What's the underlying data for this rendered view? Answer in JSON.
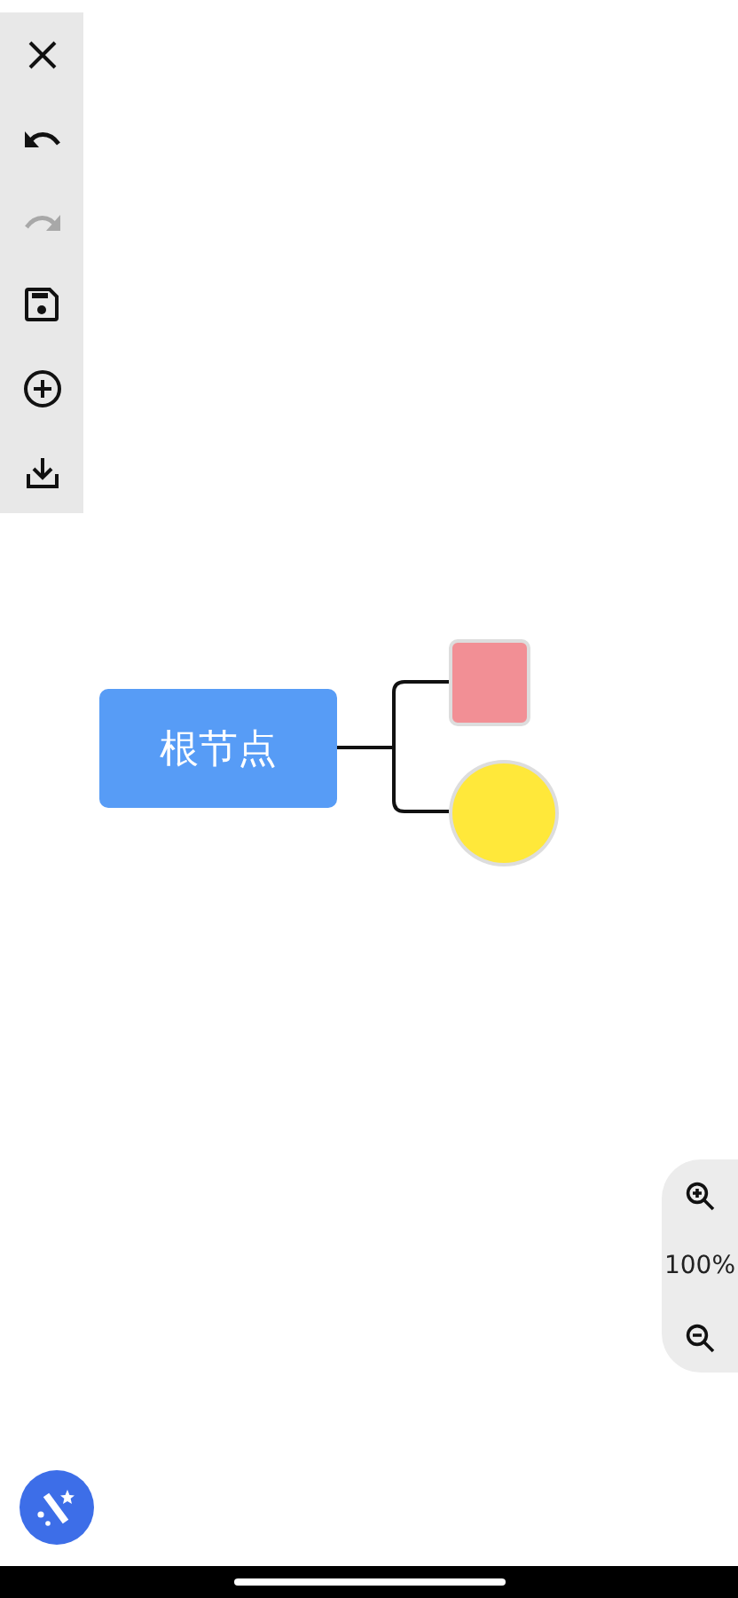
{
  "toolbar": [
    {
      "kind": "close",
      "disabled": false
    },
    {
      "kind": "undo",
      "disabled": false
    },
    {
      "kind": "redo",
      "disabled": true
    },
    {
      "kind": "save",
      "disabled": false
    },
    {
      "kind": "add",
      "disabled": false
    },
    {
      "kind": "download",
      "disabled": false
    }
  ],
  "mindmap": {
    "root": {
      "text": "根节点",
      "color": "#579cf6"
    },
    "children": [
      {
        "kind": "square",
        "color": "#f28f95"
      },
      {
        "kind": "circle",
        "color": "#ffe83a"
      }
    ]
  },
  "zoom": {
    "value": "100%"
  }
}
